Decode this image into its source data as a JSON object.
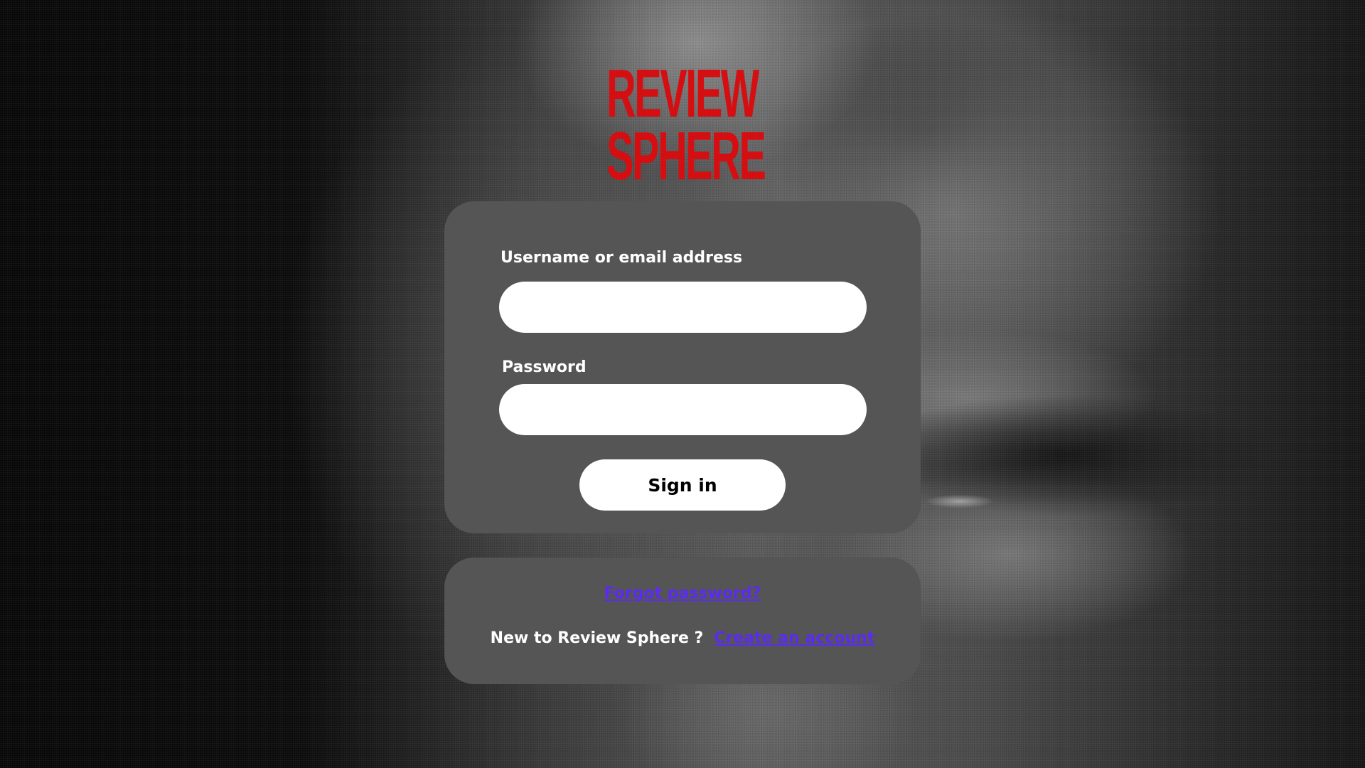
{
  "brand": {
    "logo_line1": "REVIEW",
    "logo_line2": "SPHERE",
    "logo_color": "#d50e12"
  },
  "background": {
    "image_description": "grainy black-and-white close-up photo",
    "dominant_tone": "#3a3a3a"
  },
  "login_form": {
    "username_label": "Username or email address",
    "username_value": "",
    "password_label": "Password",
    "password_value": "",
    "signin_label": "Sign in",
    "card_color": "#555555"
  },
  "links_card": {
    "forgot_password": "Forgot password?",
    "new_user_prompt": "New to Review Sphere ?",
    "create_account": "Create an account",
    "link_color": "#5b2cf0"
  }
}
